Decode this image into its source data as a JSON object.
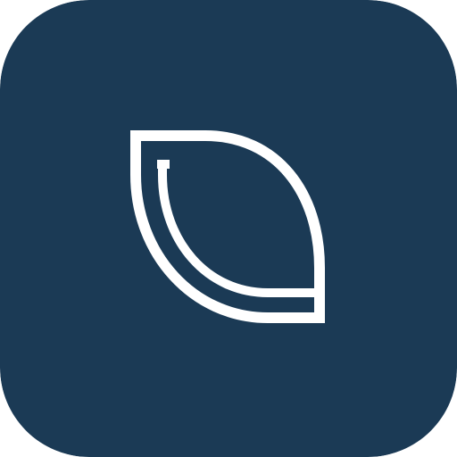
{
  "app_icon": {
    "icon_name": "leaf-logo-icon",
    "background_color": "#1B3A55",
    "mark_color": "#FFFFFF"
  }
}
